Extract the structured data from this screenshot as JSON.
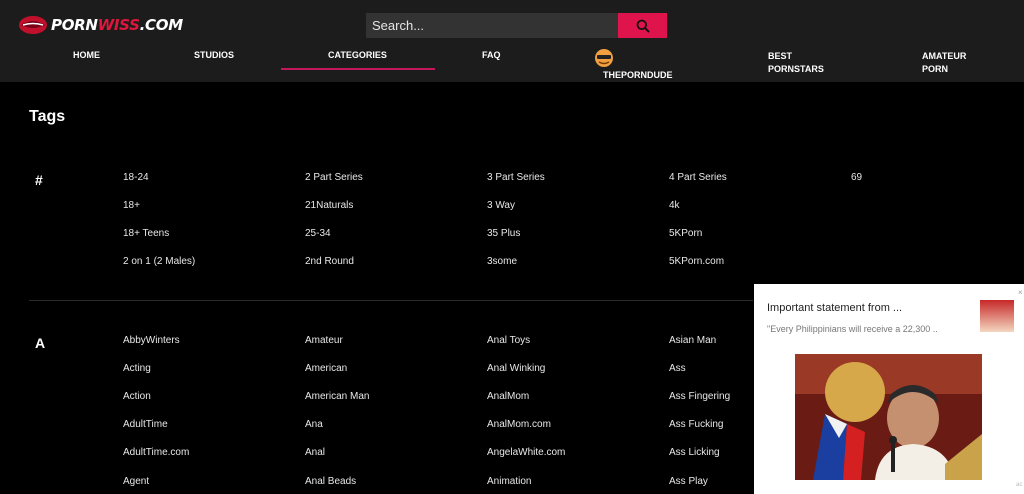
{
  "header": {
    "logo_part1": "PORN",
    "logo_part2": "WISS",
    "logo_part3": ".COM",
    "search_placeholder": "Search...",
    "search_icon": "search-icon"
  },
  "nav": {
    "items": [
      {
        "label": "HOME"
      },
      {
        "label": "STUDIOS"
      },
      {
        "label": "CATEGORIES",
        "active": true
      },
      {
        "label": "FAQ"
      },
      {
        "label": "THEPORNDUDE",
        "icon": "theporndude-icon"
      },
      {
        "label": "BEST PORNSTARS"
      },
      {
        "label": "AMATEUR PORN"
      }
    ]
  },
  "page_title": "Tags",
  "groups": [
    {
      "letter": "#",
      "tags": [
        "18-24",
        "2 Part Series",
        "3 Part Series",
        "4 Part Series",
        "69",
        "18+",
        "21Naturals",
        "3 Way",
        "4k",
        "18+ Teens",
        "25-34",
        "35 Plus",
        "5KPorn",
        "2 on 1 (2 Males)",
        "2nd Round",
        "3some",
        "5KPorn.com"
      ]
    },
    {
      "letter": "A",
      "tags": [
        "AbbyWinters",
        "Amateur",
        "Anal Toys",
        "Asian Man",
        "Acting",
        "American",
        "Anal Winking",
        "Ass",
        "Action",
        "American Man",
        "AnalMom",
        "Ass Fingering",
        "AdultTime",
        "Ana",
        "AnalMom.com",
        "Ass Fucking",
        "AdultTime.com",
        "Anal",
        "AngelaWhite.com",
        "Ass Licking",
        "Agent",
        "Anal Beads",
        "Animation",
        "Ass Play"
      ]
    }
  ],
  "ad": {
    "title": "Important statement from ...",
    "text": "\"Every Philippinians will receive a 22,300 ..",
    "close": "×",
    "corner": "ac"
  },
  "colors": {
    "accent": "#e0144c",
    "header_bg": "#1c1c1c",
    "page_bg": "#000000"
  }
}
